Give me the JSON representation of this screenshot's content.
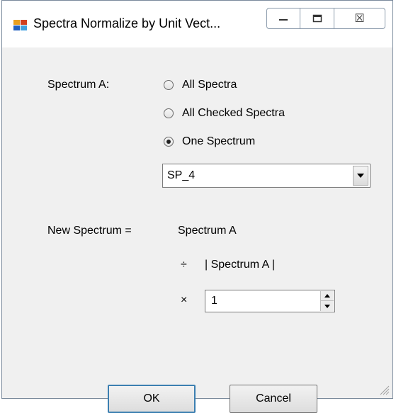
{
  "window": {
    "title": "Spectra Normalize by Unit Vect...",
    "icons": {
      "app": "app-icon",
      "minimize": "minimize-icon",
      "maximize": "maximize-icon",
      "close": "close-icon"
    },
    "close_glyph": "☒"
  },
  "form": {
    "spectrum_a_label": "Spectrum A:",
    "options": [
      {
        "label": "All Spectra",
        "checked": false
      },
      {
        "label": "All Checked Spectra",
        "checked": false
      },
      {
        "label": "One Spectrum",
        "checked": true
      }
    ],
    "spectrum_select_value": "SP_4",
    "new_spectrum_label": "New Spectrum =",
    "formula_numerator": "Spectrum A",
    "divide_symbol": "÷",
    "formula_norm": "| Spectrum A |",
    "multiply_symbol": "×",
    "factor_value": "1"
  },
  "buttons": {
    "ok": "OK",
    "cancel": "Cancel"
  },
  "colors": {
    "default_button_border": "#3c7fb1",
    "window_bg": "#f0f0f0"
  }
}
